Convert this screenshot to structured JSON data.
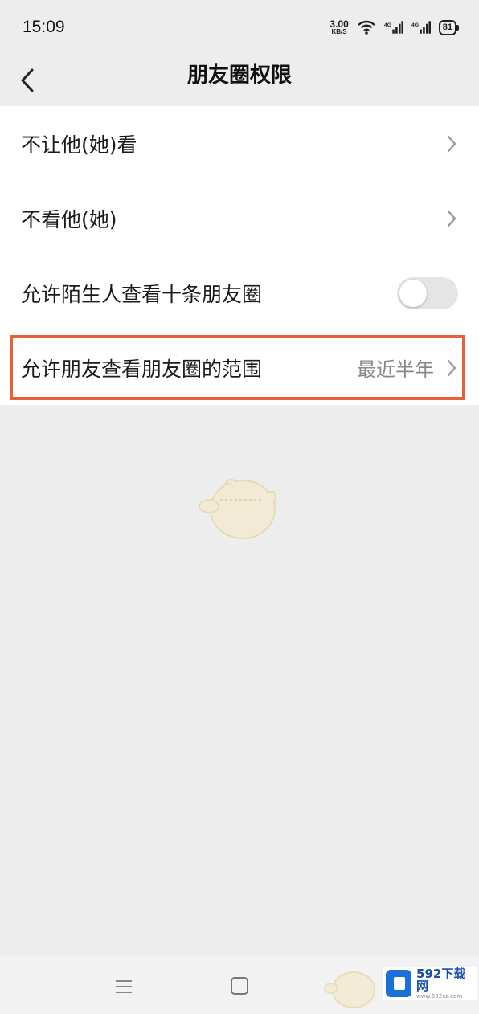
{
  "status_bar": {
    "time": "15:09",
    "net_speed_value": "3.00",
    "net_speed_unit": "KB/S",
    "signal_1_label": "4G",
    "signal_2_label": "4G",
    "battery": "81"
  },
  "nav": {
    "title": "朋友圈权限",
    "back_icon": "chevron-left-icon"
  },
  "settings": [
    {
      "label": "不让他(她)看",
      "type": "link"
    },
    {
      "label": "不看他(她)",
      "type": "link"
    },
    {
      "label": "允许陌生人查看十条朋友圈",
      "type": "toggle",
      "on": false
    },
    {
      "label": "允许朋友查看朋友圈的范围",
      "type": "link",
      "value": "最近半年"
    }
  ],
  "watermark": {
    "brand": "592下载网",
    "url": "www.592xz.com"
  },
  "colors": {
    "background": "#ededed",
    "card": "#ffffff",
    "highlight": "#e8603a",
    "watermark_blue": "#1a6fd8"
  }
}
